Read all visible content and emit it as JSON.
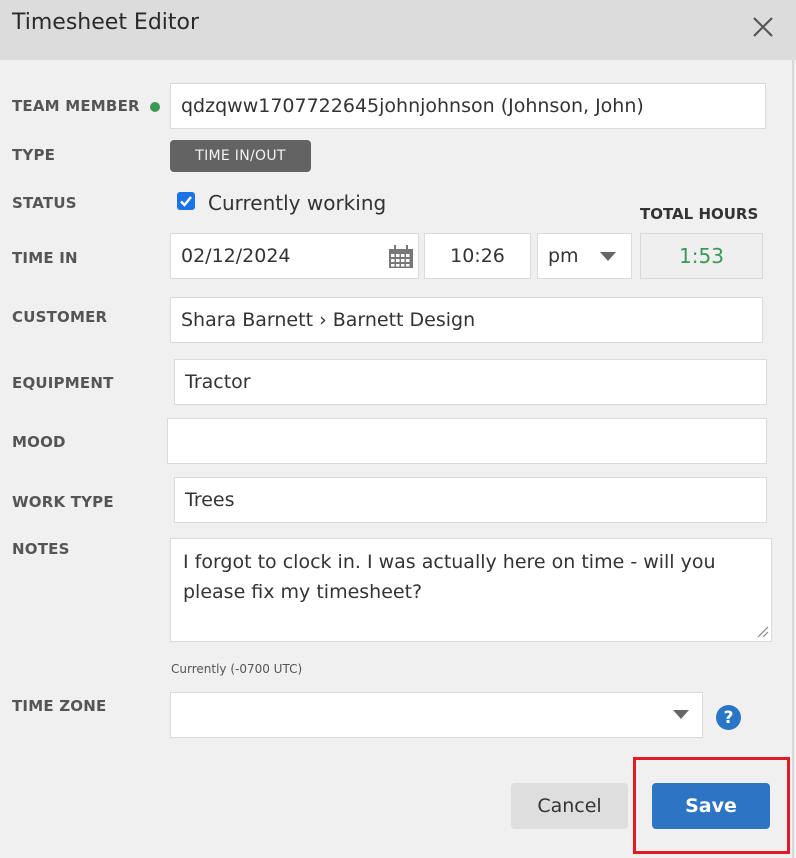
{
  "dialog": {
    "title": "Timesheet Editor",
    "close_icon": "close-icon"
  },
  "form": {
    "team_member": {
      "label": "TEAM MEMBER",
      "value": "qdzqww1707722645johnjohnson (Johnson, John)",
      "status_dot_color": "#3a9a55"
    },
    "type": {
      "label": "TYPE",
      "value": "TIME IN/OUT"
    },
    "status": {
      "label": "STATUS",
      "checkbox_label": "Currently working",
      "checked": true
    },
    "time_in": {
      "label": "TIME IN",
      "date": "02/12/2024",
      "time": "10:26",
      "meridiem": "pm"
    },
    "total_hours": {
      "label": "TOTAL HOURS",
      "value": "1:53",
      "color": "#3a9a55"
    },
    "customer": {
      "label": "CUSTOMER",
      "value": "Shara Barnett › Barnett Design"
    },
    "equipment": {
      "label": "EQUIPMENT",
      "value": "Tractor"
    },
    "mood": {
      "label": "MOOD",
      "value": ""
    },
    "work_type": {
      "label": "WORK TYPE",
      "value": "Trees"
    },
    "notes": {
      "label": "NOTES",
      "value": "I forgot to clock in. I was actually here on time - will you please fix my timesheet?"
    },
    "time_zone": {
      "label": "TIME ZONE",
      "current_note": "Currently (-0700 UTC)",
      "value": "",
      "help_icon": "?"
    }
  },
  "footer": {
    "cancel_label": "Cancel",
    "save_label": "Save",
    "accent_color": "#2d74c4",
    "highlight_color": "#e01b24"
  }
}
